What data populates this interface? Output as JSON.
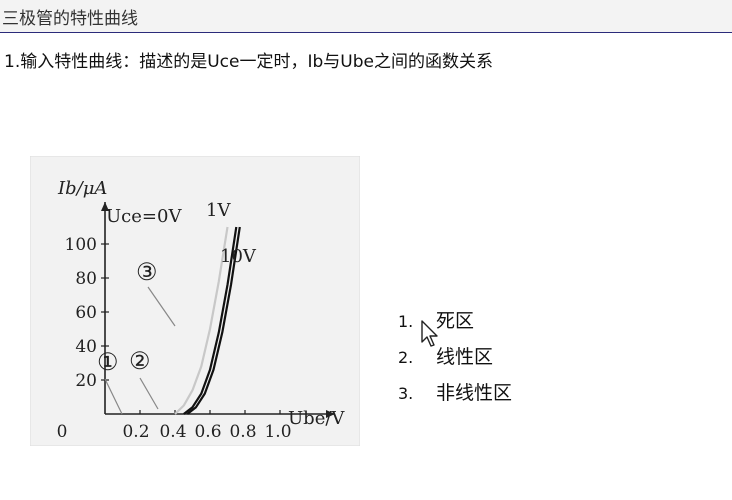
{
  "header": {
    "title": "三极管的特性曲线"
  },
  "content": {
    "subtitle": "1.输入特性曲线：描述的是Uce一定时，Ib与Ube之间的函数关系",
    "regions": [
      {
        "num": "1.",
        "label": "死区"
      },
      {
        "num": "2.",
        "label": "线性区"
      },
      {
        "num": "3.",
        "label": "非线性区"
      }
    ]
  },
  "chart_data": {
    "type": "line",
    "ylabel": "I_b/μA",
    "xlabel": "U_be/V",
    "x_ticks": [
      "0",
      "0.2",
      "0.4",
      "0.6",
      "0.8",
      "1.0"
    ],
    "y_ticks": [
      "20",
      "40",
      "60",
      "80",
      "100"
    ],
    "xlim": [
      0,
      1.1
    ],
    "ylim": [
      0,
      115
    ],
    "series": [
      {
        "name": "U_ce=0V",
        "x": [
          0.4,
          0.45,
          0.5,
          0.55,
          0.6,
          0.65,
          0.7
        ],
        "y": [
          0,
          5,
          14,
          28,
          50,
          78,
          110
        ]
      },
      {
        "name": "1V",
        "x": [
          0.45,
          0.5,
          0.55,
          0.6,
          0.65,
          0.7,
          0.75
        ],
        "y": [
          0,
          4,
          12,
          26,
          48,
          76,
          110
        ]
      },
      {
        "name": "10V",
        "x": [
          0.47,
          0.52,
          0.57,
          0.62,
          0.67,
          0.72,
          0.77
        ],
        "y": [
          0,
          4,
          12,
          26,
          48,
          76,
          110
        ]
      }
    ],
    "annotations": [
      "①",
      "②",
      "③"
    ],
    "colors": {
      "curve_light": "#cfcfcf",
      "curve_dark": "#111111",
      "background": "#f2f2f2"
    }
  }
}
